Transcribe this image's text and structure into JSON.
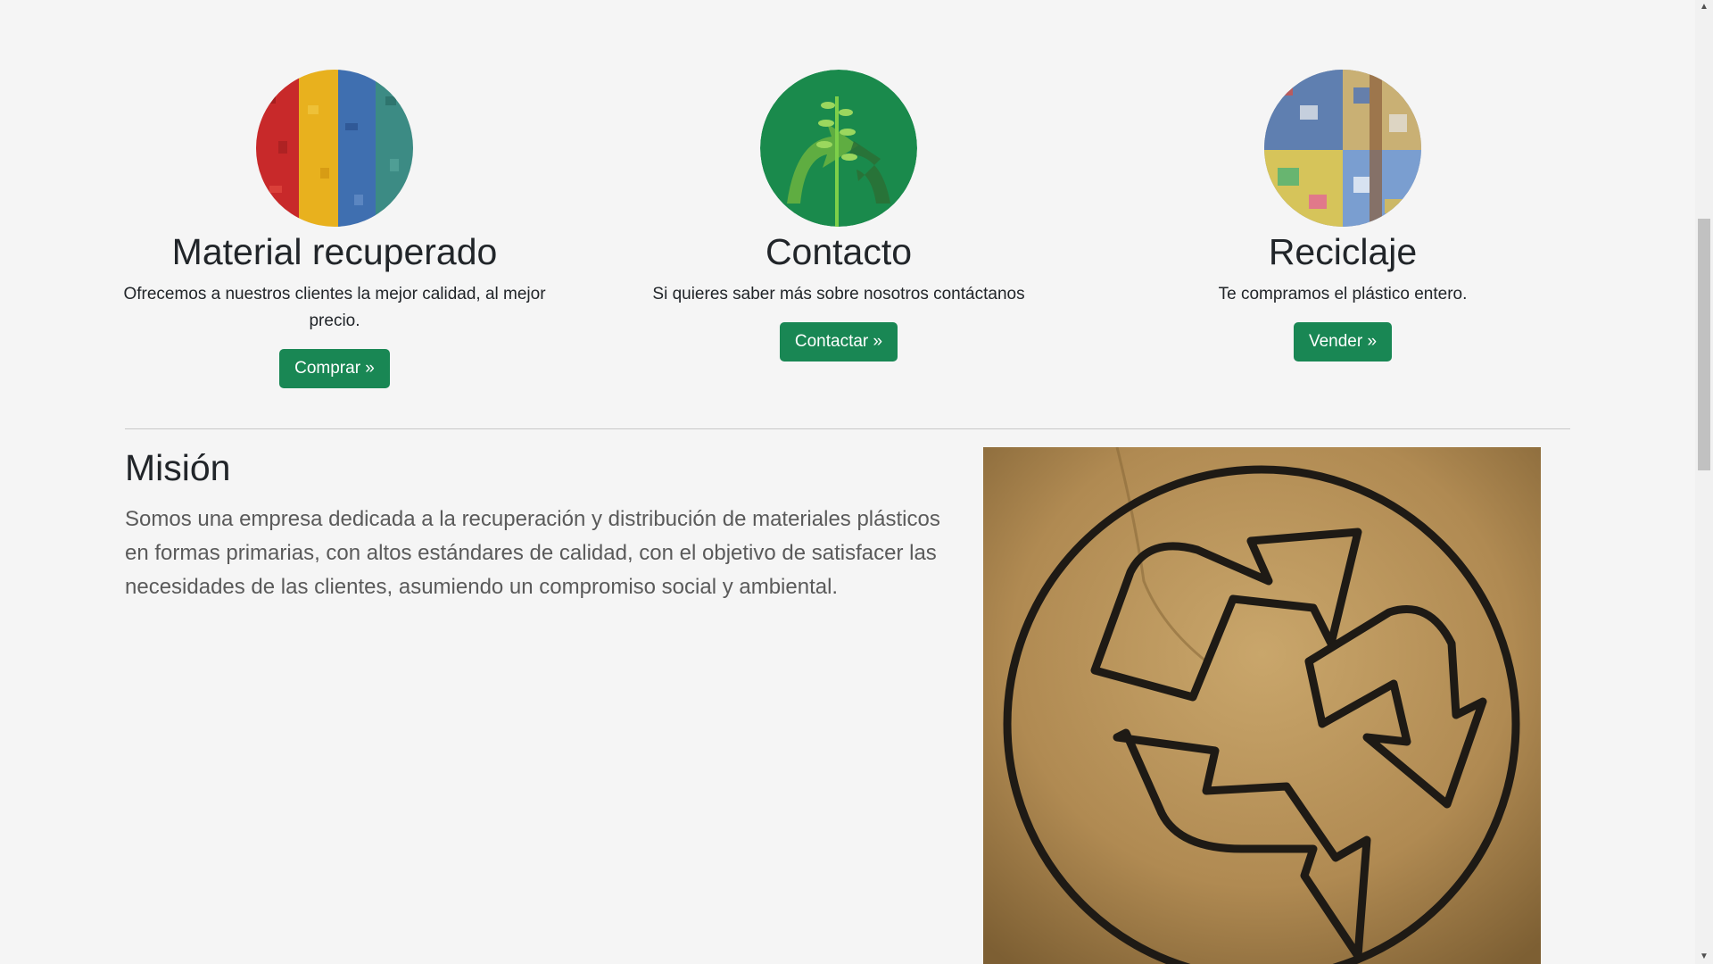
{
  "features": [
    {
      "title": "Material recuperado",
      "text": "Ofrecemos a nuestros clientes la mejor calidad, al mejor precio.",
      "button": "Comprar »",
      "icon": "plastic-flakes-image"
    },
    {
      "title": "Contacto",
      "text": "Si quieres saber más sobre nosotros contáctanos",
      "button": "Contactar »",
      "icon": "plant-recycle-image"
    },
    {
      "title": "Reciclaje",
      "text": "Te compramos el plástico entero.",
      "button": "Vender »",
      "icon": "plastic-bales-image"
    }
  ],
  "mission": {
    "title": "Misión",
    "text": "Somos una empresa dedicada a la recuperación y distribución de materiales plásticos en formas primarias, con altos estándares de calidad, con el objetivo de satisfacer las necesidades de las clientes, asumiendo un compromiso social y ambiental.",
    "image": "recycle-symbol-cardboard-image"
  },
  "colors": {
    "accent": "#198754",
    "background": "#f5f5f5"
  }
}
